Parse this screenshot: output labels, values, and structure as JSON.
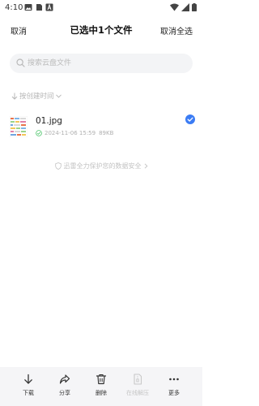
{
  "status_bar": {
    "time": "4:10"
  },
  "header": {
    "cancel_label": "取消",
    "title": "已选中1个文件",
    "deselect_all_label": "取消全选"
  },
  "search": {
    "placeholder": "搜索云盘文件"
  },
  "sort": {
    "label": "按创建时间"
  },
  "files": [
    {
      "name": "01.jpg",
      "date": "2024-11-06 15:59",
      "size": "89KB",
      "selected": true
    }
  ],
  "security_note": "迅雷全力保护您的数据安全",
  "toolbar": {
    "download_label": "下载",
    "share_label": "分享",
    "delete_label": "删除",
    "online_unzip_label": "在线解压",
    "more_label": "更多"
  },
  "colors": {
    "accent": "#3b7cf4",
    "synced_green": "#4cc46a",
    "toolbar_bg": "#f5f5f7"
  }
}
